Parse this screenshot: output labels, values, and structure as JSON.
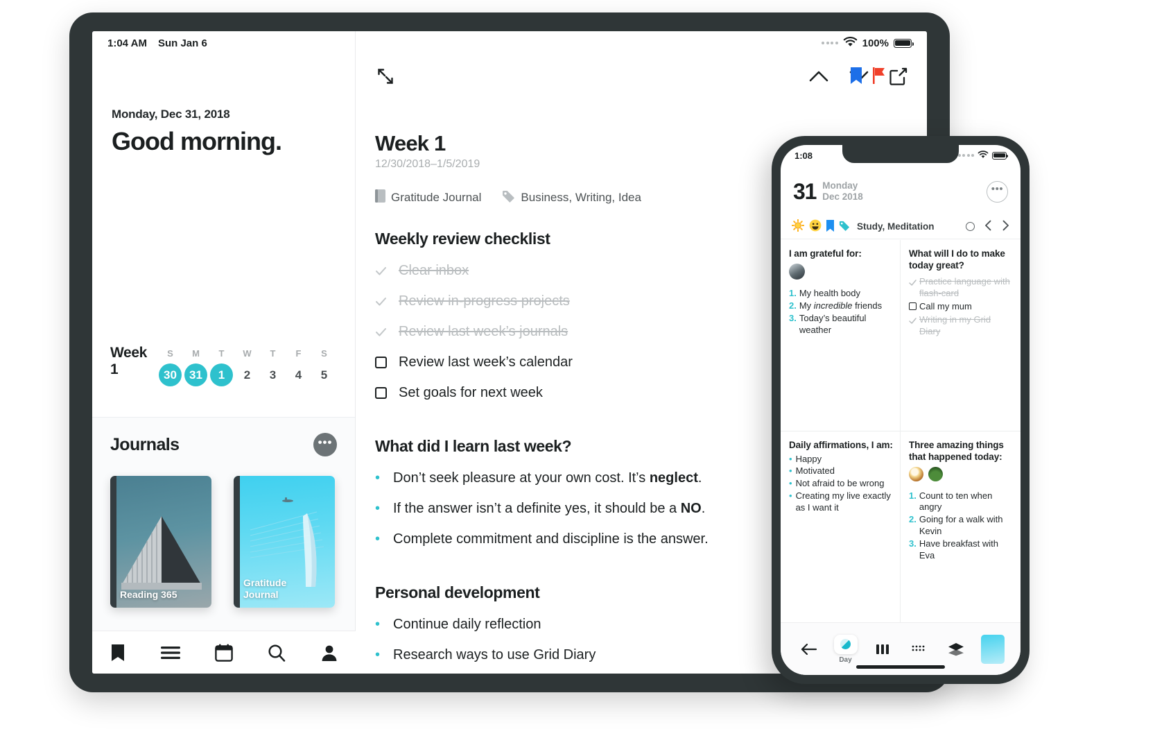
{
  "ipad": {
    "status": {
      "time": "1:04 AM",
      "date": "Sun Jan 6",
      "battery": "100%"
    },
    "sidebar": {
      "greeting_date": "Monday, Dec 31, 2018",
      "greeting": "Good morning.",
      "week_label": "Week 1",
      "week_dows": [
        "S",
        "M",
        "T",
        "W",
        "T",
        "F",
        "S"
      ],
      "week_days": [
        {
          "num": "30",
          "selected": true
        },
        {
          "num": "31",
          "selected": true
        },
        {
          "num": "1",
          "selected": true
        },
        {
          "num": "2",
          "selected": false
        },
        {
          "num": "3",
          "selected": false
        },
        {
          "num": "4",
          "selected": false
        },
        {
          "num": "5",
          "selected": false
        }
      ],
      "journals_title": "Journals",
      "journals_more": "•••",
      "books": [
        {
          "title": "Reading 365"
        },
        {
          "title": "Gratitude\nJournal"
        }
      ],
      "tabs": [
        {
          "icon": "book-icon",
          "name": "tab-journal"
        },
        {
          "icon": "list-icon",
          "name": "tab-list"
        },
        {
          "icon": "calendar-icon",
          "name": "tab-calendar"
        },
        {
          "icon": "search-icon",
          "name": "tab-search"
        },
        {
          "icon": "person-icon",
          "name": "tab-profile"
        }
      ]
    },
    "editor": {
      "title": "Week 1",
      "subtitle": "12/30/2018–1/5/2019",
      "journal_name": "Gratitude Journal",
      "tags": "Business, Writing, Idea",
      "sections": [
        {
          "heading": "Weekly review checklist",
          "type": "checklist",
          "items": [
            {
              "text": "Clear inbox",
              "done": true
            },
            {
              "text": "Review in-progress projects",
              "done": true
            },
            {
              "text": "Review last week’s journals",
              "done": true
            },
            {
              "text": "Review last week’s calendar",
              "done": false
            },
            {
              "text": "Set goals for next week",
              "done": false
            }
          ]
        },
        {
          "heading": "What did I learn last week?",
          "type": "bullets",
          "items": [
            {
              "pre": "Don’t seek pleasure at your own cost. It’s ",
              "bold": "neglect",
              "post": "."
            },
            {
              "pre": "If the answer isn’t a definite yes, it should be a ",
              "bold": "NO",
              "post": "."
            },
            {
              "pre": "Complete commitment and discipline is the answer.",
              "bold": "",
              "post": ""
            }
          ]
        },
        {
          "heading": "Personal development",
          "type": "bullets",
          "items": [
            {
              "pre": "Continue daily reflection",
              "bold": "",
              "post": ""
            },
            {
              "pre": "Research ways to use Grid Diary",
              "bold": "",
              "post": ""
            }
          ]
        }
      ]
    }
  },
  "iphone": {
    "status": {
      "time": "1:08"
    },
    "header": {
      "day": "31",
      "weekday": "Monday",
      "monthyear": "Dec 2018",
      "more": "•••"
    },
    "tags": "Study, Meditation",
    "grid": [
      {
        "heading": "I am grateful for:",
        "type": "numbered",
        "has_avatar": true,
        "items": [
          {
            "n": "1.",
            "text": "My health body"
          },
          {
            "n": "2.",
            "text": "My incredible friends",
            "italic_word": "incredible"
          },
          {
            "n": "3.",
            "text": "Today’s beautiful weather"
          }
        ]
      },
      {
        "heading": "What will I do to make today great?",
        "type": "checklist",
        "items": [
          {
            "text": "Practice language with flash-card",
            "done": true
          },
          {
            "text": "Call my mum",
            "done": false
          },
          {
            "text": "Writing in my Grid Diary",
            "done": true
          }
        ]
      },
      {
        "heading": "Daily affirmations, I am:",
        "type": "bullets",
        "items": [
          {
            "text": "Happy"
          },
          {
            "text": "Motivated"
          },
          {
            "text": "Not afraid to be wrong"
          },
          {
            "text": "Creating my live exactly as I want it"
          }
        ]
      },
      {
        "heading": "Three amazing things that happened today:",
        "type": "numbered",
        "has_emoji": true,
        "items": [
          {
            "n": "1.",
            "text": "Count to ten when angry"
          },
          {
            "n": "2.",
            "text": "Going for a walk with Kevin"
          },
          {
            "n": "3.",
            "text": "Have breakfast with Eva"
          }
        ]
      }
    ],
    "tabs": [
      {
        "label": "",
        "name": "back-button"
      },
      {
        "label": "Day",
        "name": "tab-day"
      },
      {
        "label": "",
        "name": "tab-columns"
      },
      {
        "label": "",
        "name": "tab-grid"
      },
      {
        "label": "",
        "name": "tab-layers"
      },
      {
        "label": "",
        "name": "theme-swatch"
      }
    ]
  },
  "colors": {
    "accent": "#2ec1cd",
    "bookmark": "#1d6fe8",
    "flag": "#f0402a"
  }
}
